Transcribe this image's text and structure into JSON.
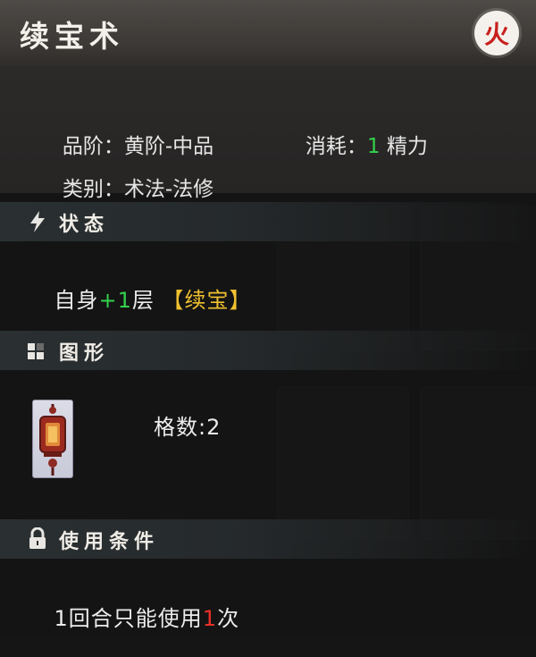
{
  "header": {
    "title": "续宝术",
    "element_badge": "火"
  },
  "info": {
    "grade_label": "品阶：",
    "grade_value": "黄阶-中品",
    "cost_label": "消耗：",
    "cost_value": "1",
    "cost_unit": "精力",
    "category_label": "类别：",
    "category_value": "术法-法修"
  },
  "status": {
    "section_title": "状态",
    "text_prefix": "自身",
    "stack_value": "+1",
    "text_suffix": "层",
    "buff_name": "【续宝】"
  },
  "shape": {
    "section_title": "图形",
    "cells_label": "格数:2"
  },
  "usage": {
    "section_title": "使用条件",
    "text_prefix": "1回合只能使用",
    "limit_value": "1",
    "text_suffix": "次"
  },
  "colors": {
    "positive": "#33d14b",
    "limit": "#f0302a",
    "buff": "#f0c030",
    "fire_badge": "#c8201c"
  },
  "icons": {
    "status": "lightning-icon",
    "shape": "grid-blocks-icon",
    "usage": "lock-icon"
  }
}
